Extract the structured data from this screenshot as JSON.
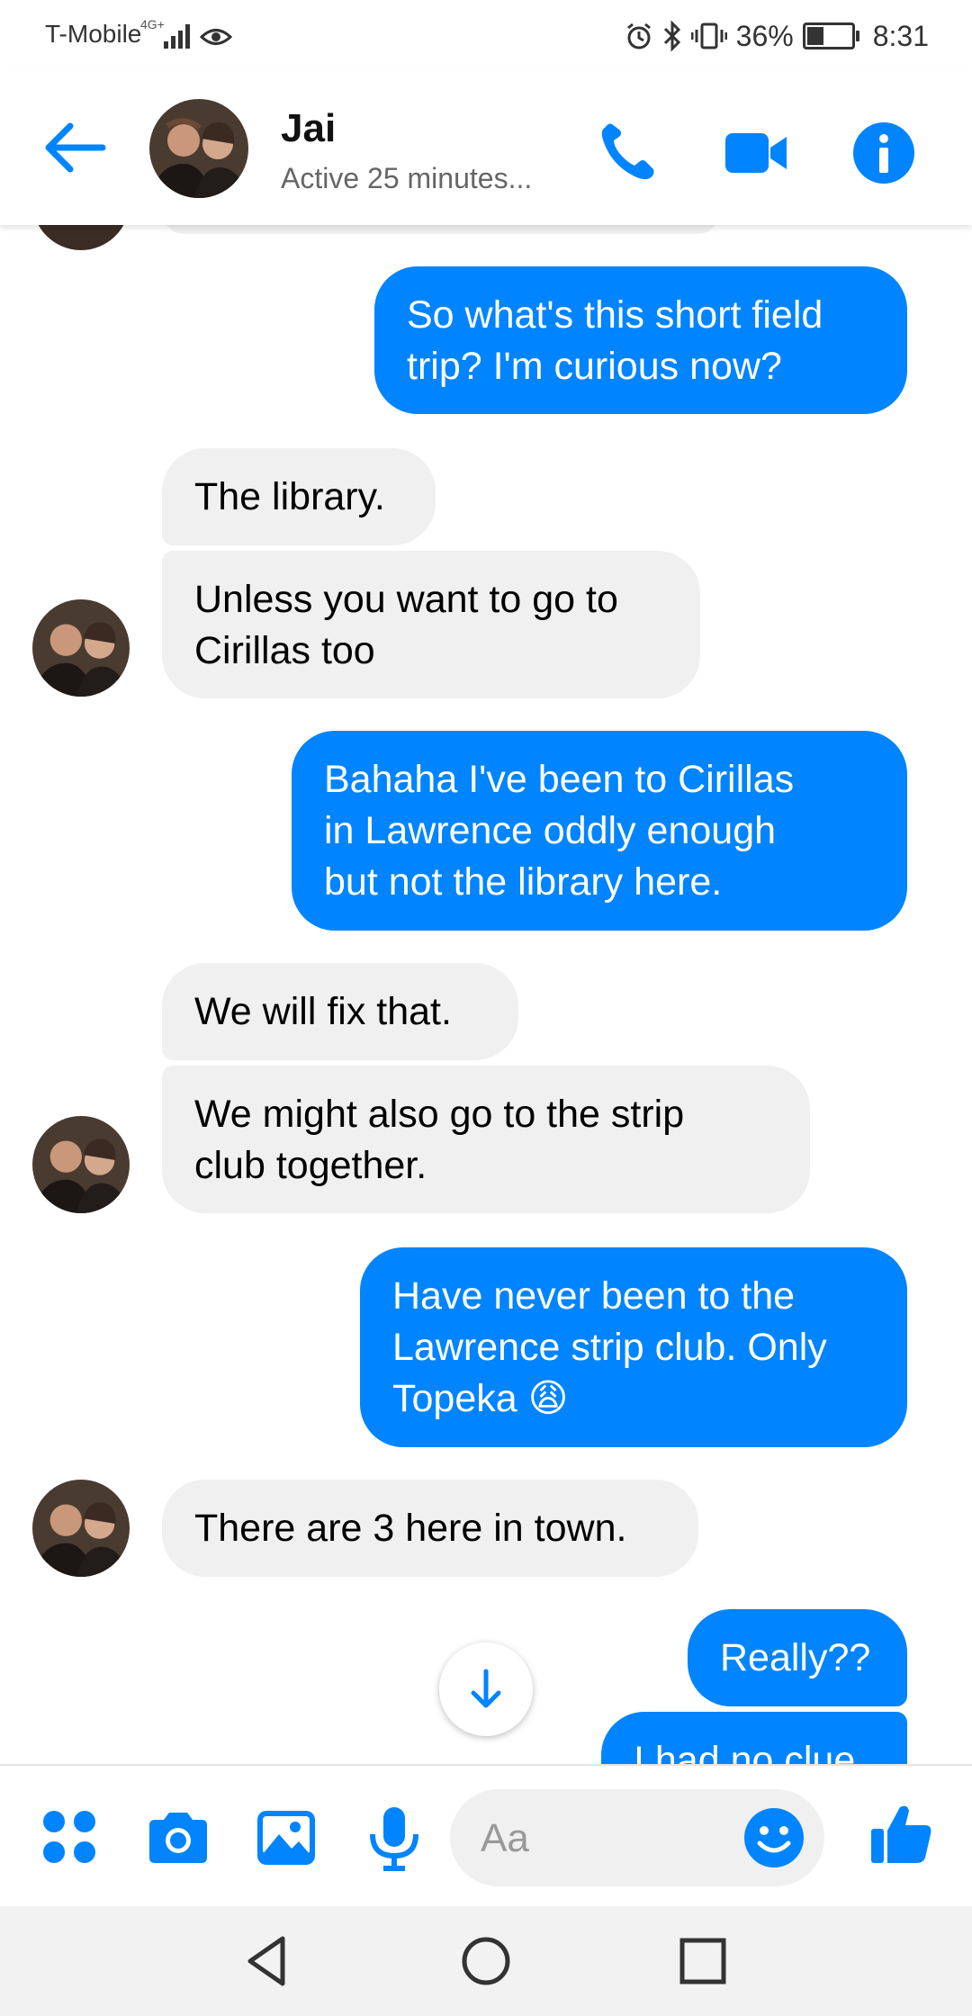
{
  "status_bar": {
    "carrier": "T-Mobile",
    "network": "4G+",
    "battery": "36%",
    "battery_level": 0.36,
    "time": "8:31"
  },
  "header": {
    "contact_name": "Jai",
    "contact_status": "Active 25 minutes..."
  },
  "messages": [
    {
      "from": "me",
      "text": "So what's this short field\ntrip? I'm curious now?"
    },
    {
      "from": "them",
      "text": "The library."
    },
    {
      "from": "them",
      "text": "Unless you want to go to\nCirillas too"
    },
    {
      "from": "me",
      "text": "Bahaha I've been to Cirillas\nin Lawrence oddly enough\nbut not the library here."
    },
    {
      "from": "them",
      "text": "We will fix that."
    },
    {
      "from": "them",
      "text": "We might also go to the strip\nclub together."
    },
    {
      "from": "me",
      "text": "Have never been to the\nLawrence strip club. Only\nTopeka 😩"
    },
    {
      "from": "them",
      "text": "There are 3 here in town."
    },
    {
      "from": "me",
      "text": "Really??"
    },
    {
      "from": "me",
      "text": "I had no clue"
    }
  ],
  "composer": {
    "placeholder": "Aa"
  },
  "colors": {
    "accent": "#0084ff",
    "received_bubble": "#f0f0f0",
    "sent_text": "#ffffff"
  },
  "icons": {
    "back": "arrow-left-icon",
    "call": "phone-icon",
    "video": "video-camera-icon",
    "info": "info-icon",
    "more": "four-dots-icon",
    "camera": "camera-icon",
    "gallery": "image-icon",
    "mic": "microphone-icon",
    "emoji": "smiley-icon",
    "like": "thumbs-up-icon",
    "scroll": "arrow-down-icon"
  }
}
